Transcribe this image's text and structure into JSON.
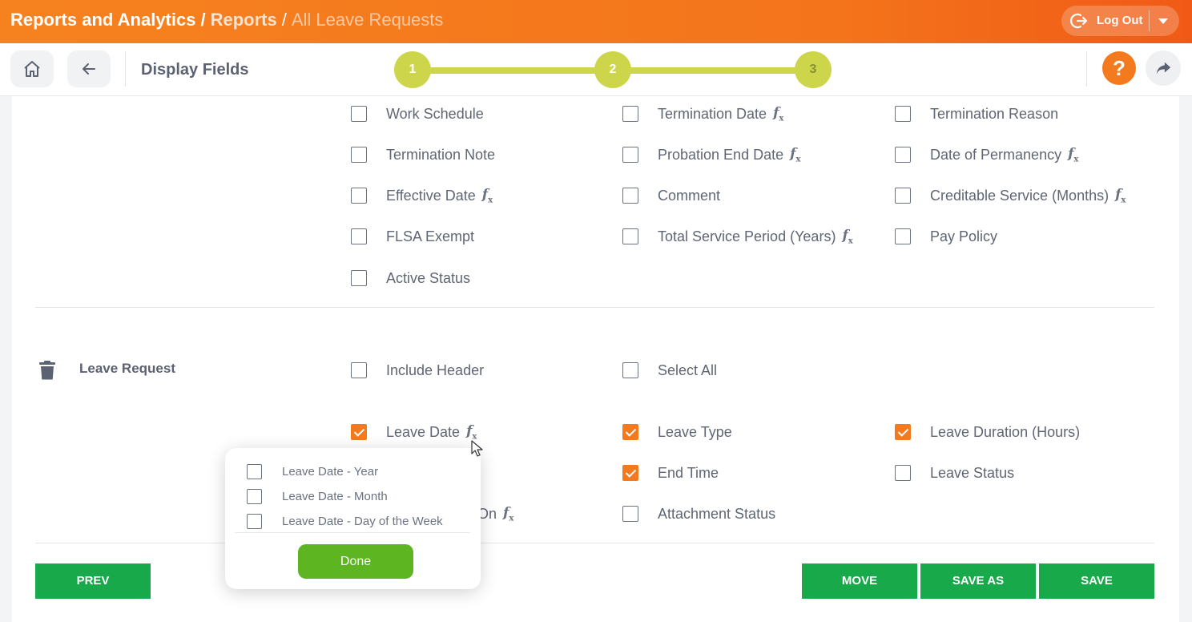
{
  "header": {
    "crumb1": "Reports and Analytics",
    "crumb2": "Reports",
    "crumb3": "All Leave Requests",
    "separator": "/",
    "logout_label": "Log Out",
    "accent": "#f47a1f"
  },
  "subheader": {
    "title": "Display Fields",
    "steps": [
      "1",
      "2",
      "3"
    ],
    "help_label": "?"
  },
  "fields_top": [
    {
      "label": "Work Schedule",
      "checked": false,
      "fx": false
    },
    {
      "label": "Termination Date",
      "checked": false,
      "fx": true
    },
    {
      "label": "Termination Reason",
      "checked": false,
      "fx": false
    },
    {
      "label": "Termination Note",
      "checked": false,
      "fx": false
    },
    {
      "label": "Probation End Date",
      "checked": false,
      "fx": true
    },
    {
      "label": "Date of Permanency",
      "checked": false,
      "fx": true
    },
    {
      "label": "Effective Date",
      "checked": false,
      "fx": true
    },
    {
      "label": "Comment",
      "checked": false,
      "fx": false
    },
    {
      "label": "Creditable Service (Months)",
      "checked": false,
      "fx": true
    },
    {
      "label": "FLSA Exempt",
      "checked": false,
      "fx": false
    },
    {
      "label": "Total Service Period (Years)",
      "checked": false,
      "fx": true
    },
    {
      "label": "Pay Policy",
      "checked": false,
      "fx": false
    },
    {
      "label": "Active Status",
      "checked": false,
      "fx": false
    }
  ],
  "leave_section": {
    "title": "Leave Request",
    "include_header": "Include Header",
    "select_all": "Select All",
    "fields": [
      {
        "label": "Leave Date",
        "checked": true,
        "fx": true
      },
      {
        "label": "Leave Type",
        "checked": true,
        "fx": false
      },
      {
        "label": "Leave Duration (Hours)",
        "checked": true,
        "fx": false
      },
      {
        "label": "End Time",
        "checked": true,
        "fx": false
      },
      {
        "label": "Leave Status",
        "checked": false,
        "fx": false
      },
      {
        "label": "On",
        "checked": false,
        "fx": true
      },
      {
        "label": "Attachment Status",
        "checked": false,
        "fx": false
      }
    ]
  },
  "popover": {
    "options": [
      "Leave Date - Year",
      "Leave Date - Month",
      "Leave Date - Day of the Week"
    ],
    "done_label": "Done"
  },
  "footer": {
    "prev": "PREV",
    "move": "MOVE",
    "save_as": "SAVE AS",
    "save": "SAVE"
  },
  "fx_symbol": "f",
  "fx_sub": "x"
}
